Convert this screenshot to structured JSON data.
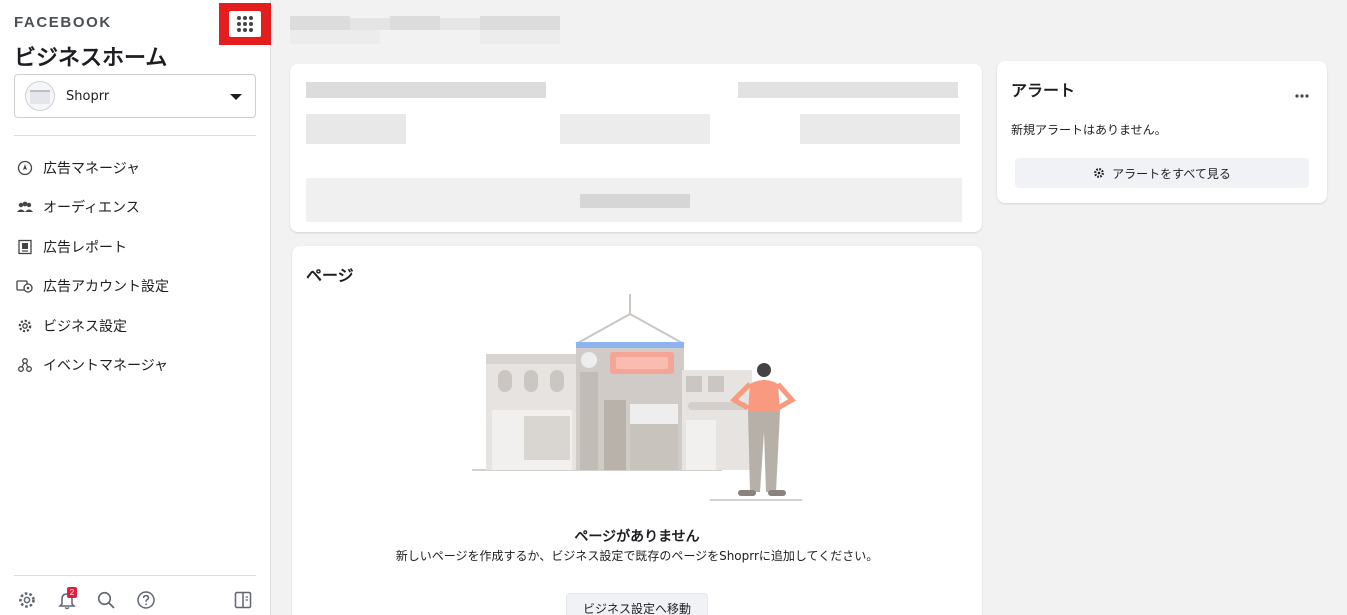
{
  "sidebar": {
    "brand": "FACEBOOK",
    "title": "ビジネスホーム",
    "apps_icon": "grid-9-dots-icon",
    "account": {
      "name": "Shoprr",
      "caret_icon": "caret-down-icon"
    },
    "nav": [
      {
        "label": "広告マネージャ",
        "icon": "compass-icon"
      },
      {
        "label": "オーディエンス",
        "icon": "people-icon"
      },
      {
        "label": "広告レポート",
        "icon": "report-icon"
      },
      {
        "label": "広告アカウント設定",
        "icon": "ad-account-icon"
      },
      {
        "label": "ビジネス設定",
        "icon": "gear-icon"
      },
      {
        "label": "イベントマネージャ",
        "icon": "events-icon"
      }
    ],
    "bottom": {
      "settings_icon": "gear-icon",
      "notifications_icon": "bell-icon",
      "notification_count": "2",
      "search_icon": "search-icon",
      "help_icon": "help-icon",
      "panel_icon": "panel-toggle-icon"
    }
  },
  "alerts": {
    "title": "アラート",
    "more_icon": "more-icon",
    "empty": "新規アラートはありません。",
    "view_all": "アラートをすべて見る"
  },
  "pages": {
    "title": "ページ",
    "empty_title": "ページがありません",
    "empty_desc": "新しいページを作成するか、ビジネス設定で既存のページをShoprrに追加してください。",
    "goto_button": "ビジネス設定へ移動"
  },
  "colors": {
    "apps_highlight": "#e41e1e",
    "badge": "#e41e3f",
    "awning": "#8fb2f0",
    "sign": "#f4a595",
    "figure_top": "#f89980"
  }
}
